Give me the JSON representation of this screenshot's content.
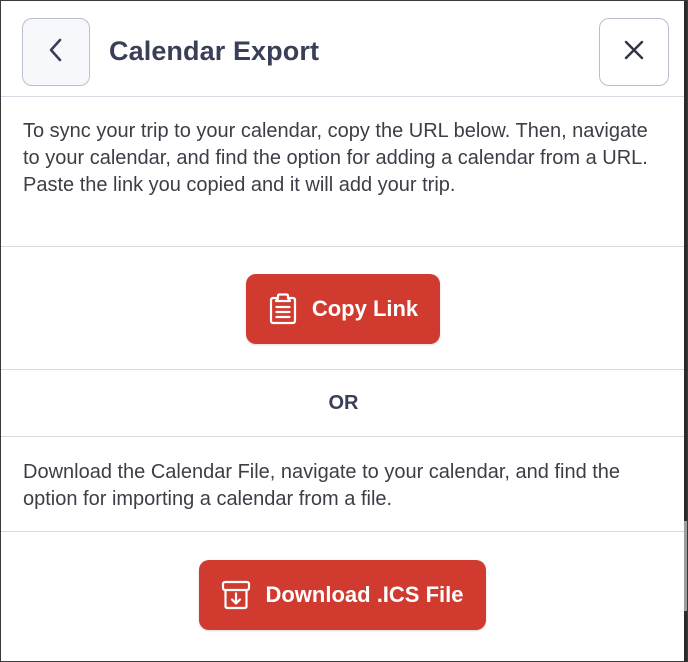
{
  "header": {
    "title": "Calendar Export",
    "back_icon": "chevron-left-icon",
    "close_icon": "close-icon"
  },
  "intro": {
    "text": "To sync your trip to your calendar, copy the URL below. Then, navigate to your calendar, and find the option for adding a calendar from a URL. Paste the link you copied and it will add your trip."
  },
  "copy_link": {
    "label": "Copy Link",
    "icon": "clipboard-icon"
  },
  "divider": {
    "label": "OR"
  },
  "download": {
    "description": "Download the Calendar File, navigate to your calendar, and find the option for importing a calendar from a file.",
    "label": "Download .ICS File",
    "icon": "download-box-icon"
  },
  "colors": {
    "accent": "#d03a2f",
    "title_text": "#3a3f58",
    "body_text": "#3d3d48",
    "divider": "#d6dae3"
  }
}
